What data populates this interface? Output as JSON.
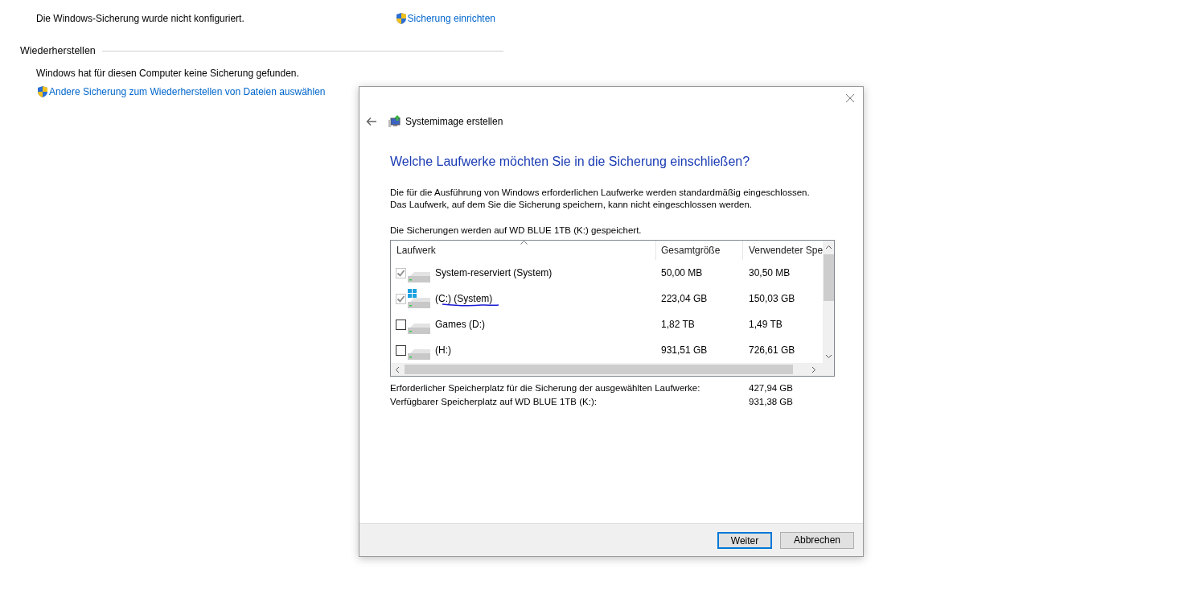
{
  "background": {
    "backup_status": "Die Windows-Sicherung wurde nicht konfiguriert.",
    "setup_link": "Sicherung einrichten",
    "restore_heading": "Wiederherstellen",
    "restore_status": "Windows hat für diesen Computer keine Sicherung gefunden.",
    "restore_link": "Andere Sicherung zum Wiederherstellen von Dateien auswählen"
  },
  "dialog": {
    "title": "Systemimage erstellen",
    "heading": "Welche Laufwerke möchten Sie in die Sicherung einschließen?",
    "description": [
      "Die für die Ausführung von Windows erforderlichen Laufwerke werden standardmäßig eingeschlossen.",
      "Das Laufwerk, auf dem Sie die Sicherung speichern, kann nicht eingeschlossen werden."
    ],
    "target_note": "Die Sicherungen werden auf WD BLUE 1TB (K:) gespeichert.",
    "table": {
      "columns": [
        "Laufwerk",
        "Gesamtgröße",
        "Verwendeter Spe"
      ],
      "rows": [
        {
          "name": "System-reserviert (System)",
          "total": "50,00 MB",
          "used": "30,50 MB",
          "checked": true,
          "disabled": true,
          "os": false,
          "underlined": false
        },
        {
          "name": "(C:) (System)",
          "total": "223,04 GB",
          "used": "150,03 GB",
          "checked": true,
          "disabled": true,
          "os": true,
          "underlined": true
        },
        {
          "name": "Games (D:)",
          "total": "1,82 TB",
          "used": "1,49 TB",
          "checked": false,
          "disabled": false,
          "os": false,
          "underlined": false
        },
        {
          "name": "(H:)",
          "total": "931,51 GB",
          "used": "726,61 GB",
          "checked": false,
          "disabled": false,
          "os": false,
          "underlined": false
        }
      ]
    },
    "summary": [
      {
        "label": "Erforderlicher Speicherplatz für die Sicherung der ausgewählten Laufwerke:",
        "value": "427,94 GB"
      },
      {
        "label": "Verfügbarer Speicherplatz auf WD BLUE 1TB (K:):",
        "value": "931,38 GB"
      }
    ],
    "buttons": [
      {
        "label": "Weiter",
        "default": true
      },
      {
        "label": "Abbrechen",
        "default": false
      }
    ]
  }
}
